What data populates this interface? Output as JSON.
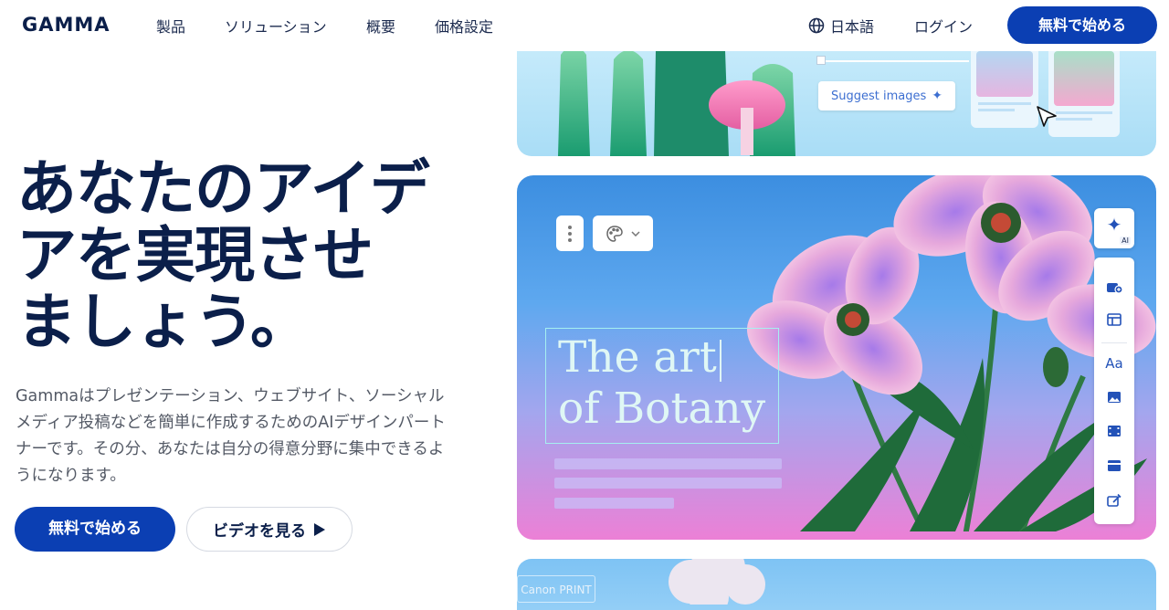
{
  "nav": {
    "logo": "GAMMA",
    "links": [
      "製品",
      "ソリューション",
      "概要",
      "価格設定"
    ],
    "language": "日本語",
    "login": "ログイン",
    "cta": "無料で始める"
  },
  "hero": {
    "title_lines": [
      "あなたのアイデ",
      "アを実現させ",
      "ましょう。"
    ],
    "subtitle_lines": [
      "Gammaはプレゼンテーション、ウェブサイト、ソーシャル",
      "メディア投稿などを簡単に作成するためのAIデザインパート",
      "ナーです。その分、あなたは自分の得意分野に集中できるよ",
      "うになります。"
    ],
    "primary_button": "無料で始める",
    "secondary_button": "ビデオを見る"
  },
  "visual": {
    "suggest_images": "Suggest images",
    "art_title_line1": "The art",
    "art_title_line2": "of Botany",
    "ai_badge": "AI",
    "font_tool": "Aa",
    "bottom_card_label": "Canon PRINT"
  },
  "colors": {
    "brand_navy": "#0b1f4a",
    "cta_blue": "#0b3fb3",
    "tool_icon_blue": "#2352b8"
  }
}
